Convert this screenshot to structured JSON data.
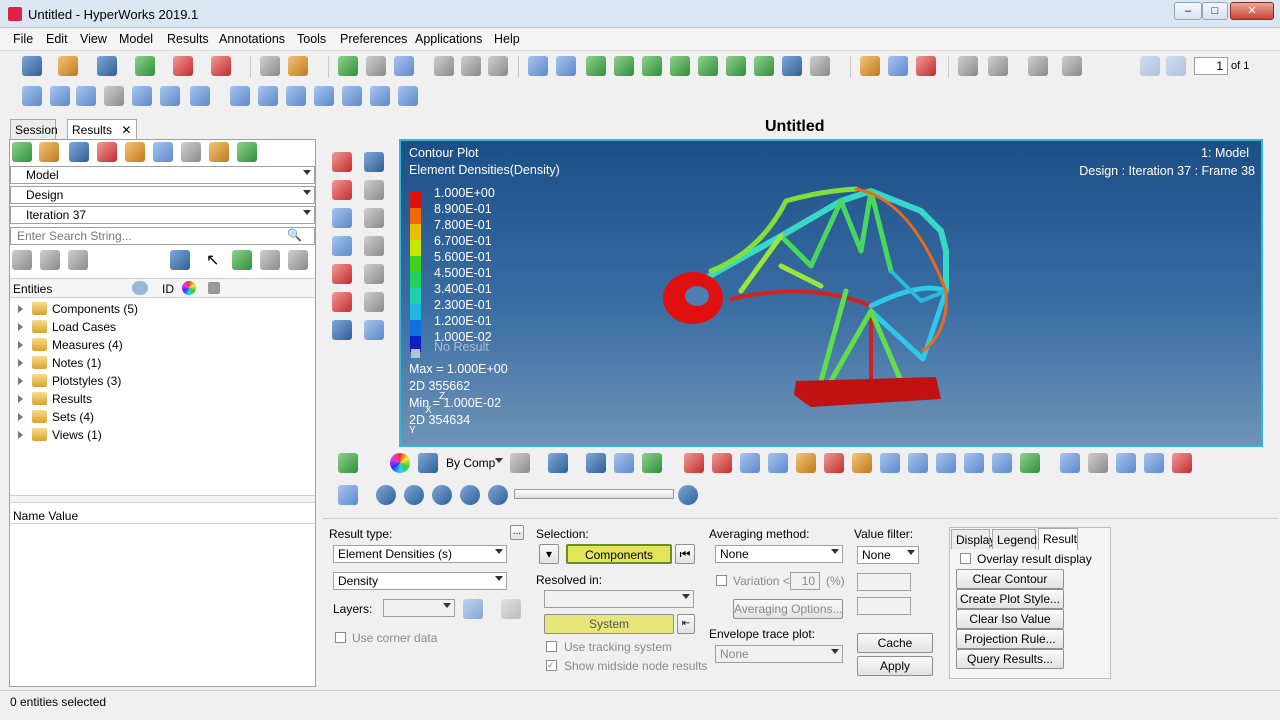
{
  "window": {
    "title": "Untitled - HyperWorks 2019.1",
    "controls": [
      "–",
      "□",
      "✕"
    ]
  },
  "menu": [
    "File",
    "Edit",
    "View",
    "Model",
    "Results",
    "Annotations",
    "Tools",
    "Preferences",
    "Applications",
    "Help"
  ],
  "page_nav": {
    "current": "1",
    "of_label": "of 1"
  },
  "left_panel": {
    "tabs": [
      "Session",
      "Results"
    ],
    "tab_close": "✕",
    "model_select": "Model",
    "design_select": "Design",
    "iteration_select": "Iteration 37",
    "search_placeholder": "Enter Search String...",
    "entity_header": {
      "entities": "Entities",
      "id": "ID"
    },
    "tree": [
      "Components (5)",
      "Load Cases",
      "Measures (4)",
      "Notes (1)",
      "Plotstyles (3)",
      "Results",
      "Sets (4)",
      "Views (1)"
    ],
    "name_value_header": "Name Value"
  },
  "page_title": "Untitled",
  "viewport": {
    "title": "Contour Plot",
    "subtitle": "Element Densities(Density)",
    "model_label": "1: Model",
    "frame_label": "Design : Iteration 37 : Frame 38",
    "legend": [
      {
        "value": "1.000E+00",
        "color": "#e01010"
      },
      {
        "value": "8.900E-01",
        "color": "#f06a00"
      },
      {
        "value": "7.800E-01",
        "color": "#e8c000"
      },
      {
        "value": "6.700E-01",
        "color": "#c8e600"
      },
      {
        "value": "5.600E-01",
        "color": "#40d020"
      },
      {
        "value": "4.500E-01",
        "color": "#20d060"
      },
      {
        "value": "3.400E-01",
        "color": "#20d0b0"
      },
      {
        "value": "2.300E-01",
        "color": "#20b8e0"
      },
      {
        "value": "1.200E-01",
        "color": "#1070e0"
      },
      {
        "value": "1.000E-02",
        "color": "#1020c0"
      }
    ],
    "no_result": "No Result",
    "max_label": "Max = 1.000E+00",
    "max_id": "2D 355662",
    "min_label": "Min = 1.000E-02",
    "min_id": "2D 354634",
    "triad": {
      "z": "Z",
      "x": "X",
      "y": "Y"
    }
  },
  "contour_toolbar": {
    "by_comp": "By Comp"
  },
  "result_panel": {
    "result_type_label": "Result type:",
    "result_type_value": "Element Densities (s)",
    "density_value": "Density",
    "layers_label": "Layers:",
    "use_corner_data": "Use corner data",
    "selection_label": "Selection:",
    "components_btn": "Components",
    "resolved_in_label": "Resolved in:",
    "system_btn": "System",
    "use_tracking": "Use tracking system",
    "show_midside": "Show midside node results",
    "averaging_label": "Averaging method:",
    "averaging_value": "None",
    "variation_label": "Variation <",
    "variation_value": "10",
    "variation_unit": "(%)",
    "averaging_options": "Averaging Options...",
    "envelope_label": "Envelope trace plot:",
    "envelope_value": "None",
    "value_filter_label": "Value filter:",
    "value_filter_value": "None",
    "cache_btn": "Cache",
    "apply_btn": "Apply",
    "right_tabs": [
      "Display",
      "Legend",
      "Result"
    ],
    "overlay_label": "Overlay result display",
    "buttons": [
      "Clear Contour",
      "Create Plot Style...",
      "Clear Iso Value",
      "Projection Rule...",
      "Query Results..."
    ]
  },
  "status": "0 entities selected"
}
